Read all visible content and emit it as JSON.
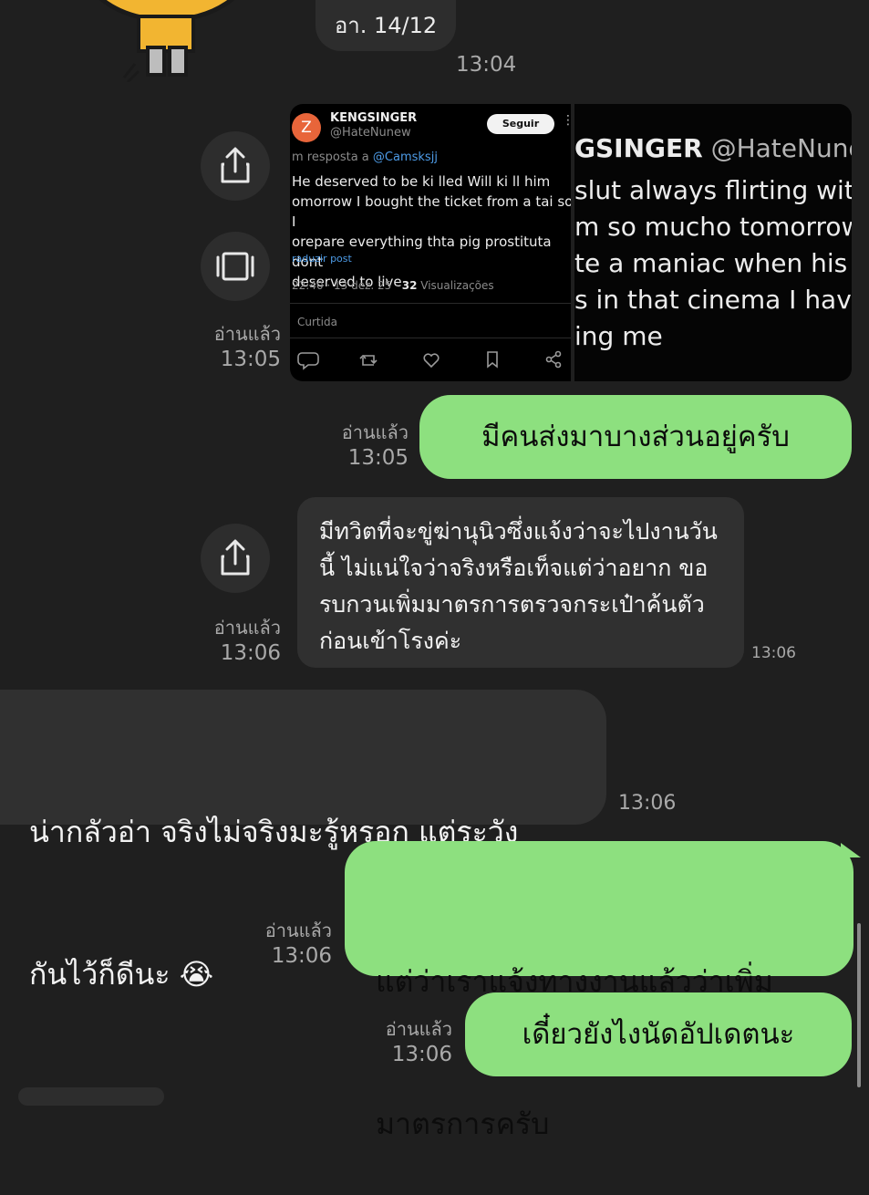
{
  "header": {
    "date_label": "อา. 14/12",
    "time": "13:04"
  },
  "actions": {
    "share_icon": "share-icon",
    "gallery_icon": "gallery-icon"
  },
  "image_message": {
    "read_label": "อ่านแล้ว",
    "time": "13:05",
    "tweet": {
      "avatar_letter": "Z",
      "name": "KENGSINGER",
      "handle": "@HateNunew",
      "follow_label": "Seguir",
      "reply_prefix": "m resposta a",
      "reply_mention": "@Camsksjj",
      "body_lines": [
        "He deserved to be ki lled Will ki ll him",
        "omorrow I bought the ticket from a tai so I",
        "orepare everything thta pig prostituta dont",
        "deserved to live"
      ],
      "translate_label": "raduzir post",
      "stats_prefix": "22:40 · 13 dez. 25 · ",
      "views_count": "32",
      "views_label": " Visualizações",
      "liked_label": "Curtida"
    },
    "zoom_tweet": {
      "name": "GSINGER",
      "handle": "@HateNune",
      "lines": [
        "slut always flirting with",
        "m so mucho tomorrow",
        "te a maniac when his b",
        "s in that cinema I have",
        "ing me"
      ]
    }
  },
  "messages": [
    {
      "side": "right",
      "read_label": "อ่านแล้ว",
      "time": "13:05",
      "text": "มีคนส่งมาบางส่วนอยู่ครับ"
    },
    {
      "side": "forward",
      "read_label": "อ่านแล้ว",
      "time": "13:06",
      "bubble_time": "13:06",
      "lines": [
        "มีทวิตที่จะขู่ฆ่านุนิวซึ่งแจ้งว่าจะไปงานวัน",
        "นี้ ไม่แน่ใจว่าจริงหรือเท็จแต่ว่าอยาก ขอ",
        "รบกวนเพิ่มมาตรการตรวจกระเป๋าค้นตัว",
        "ก่อนเข้าโรงค่ะ"
      ]
    },
    {
      "side": "left",
      "time": "13:06",
      "lines": [
        "น่ากลัวอ่า จริงไม่จริงมะรู้หรอก แต่ระวัง",
        "กันไว้ก็ดีนะ 😭"
      ]
    },
    {
      "side": "right",
      "read_label": "อ่านแล้ว",
      "time": "13:06",
      "lines": [
        "แต่ว่าเราแจ้งทางงานแล้วว่าเพิ่ม",
        "มาตรการครับ"
      ]
    },
    {
      "side": "right",
      "read_label": "อ่านแล้ว",
      "time": "13:06",
      "text": "เดี๋ยวยังไงนัดอัปเดตนะ"
    }
  ],
  "colors": {
    "background": "#1f1f1f",
    "green_bubble": "#8de07f",
    "dark_bubble": "#303030",
    "meta_text": "#a9a9a9"
  }
}
